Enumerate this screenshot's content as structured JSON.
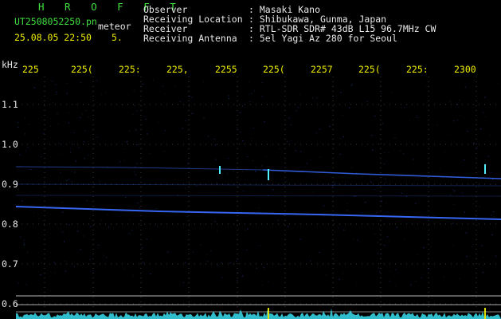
{
  "header": {
    "title": "H R O F F T",
    "filename": "UT2508052250.pn",
    "mode": "meteor",
    "datetime": "25.08.05 22:50",
    "count": "5.",
    "observer_label": "Observer",
    "observer_value": ": Masaki Kano",
    "location_label": "Receiving Location",
    "location_value": ": Shibukawa, Gunma, Japan",
    "receiver_label": "Receiver",
    "receiver_value": ": RTL-SDR SDR# 43dB L15 96.7MHz CW",
    "antenna_label": "Receiving Antenna",
    "antenna_value": ": 5el Yagi Az 280 for Seoul"
  },
  "axis": {
    "y_unit": "kHz",
    "x_ticks": [
      "225",
      "225(",
      "225:",
      "225,",
      "2255",
      "225(",
      "2257",
      "225(",
      "225:",
      "2300"
    ],
    "y_ticks": [
      "1.1",
      "1.0",
      "0.9",
      "0.8",
      "0.7",
      "0.6"
    ]
  },
  "colors": {
    "background": "#000000",
    "label_text": "#e8e8e8",
    "tick_text": "#f0f000",
    "title_text": "#3fe03f",
    "grid": "#3a3a3a",
    "signal": "#3a6cff",
    "spectrum": "#35d0e0"
  }
}
